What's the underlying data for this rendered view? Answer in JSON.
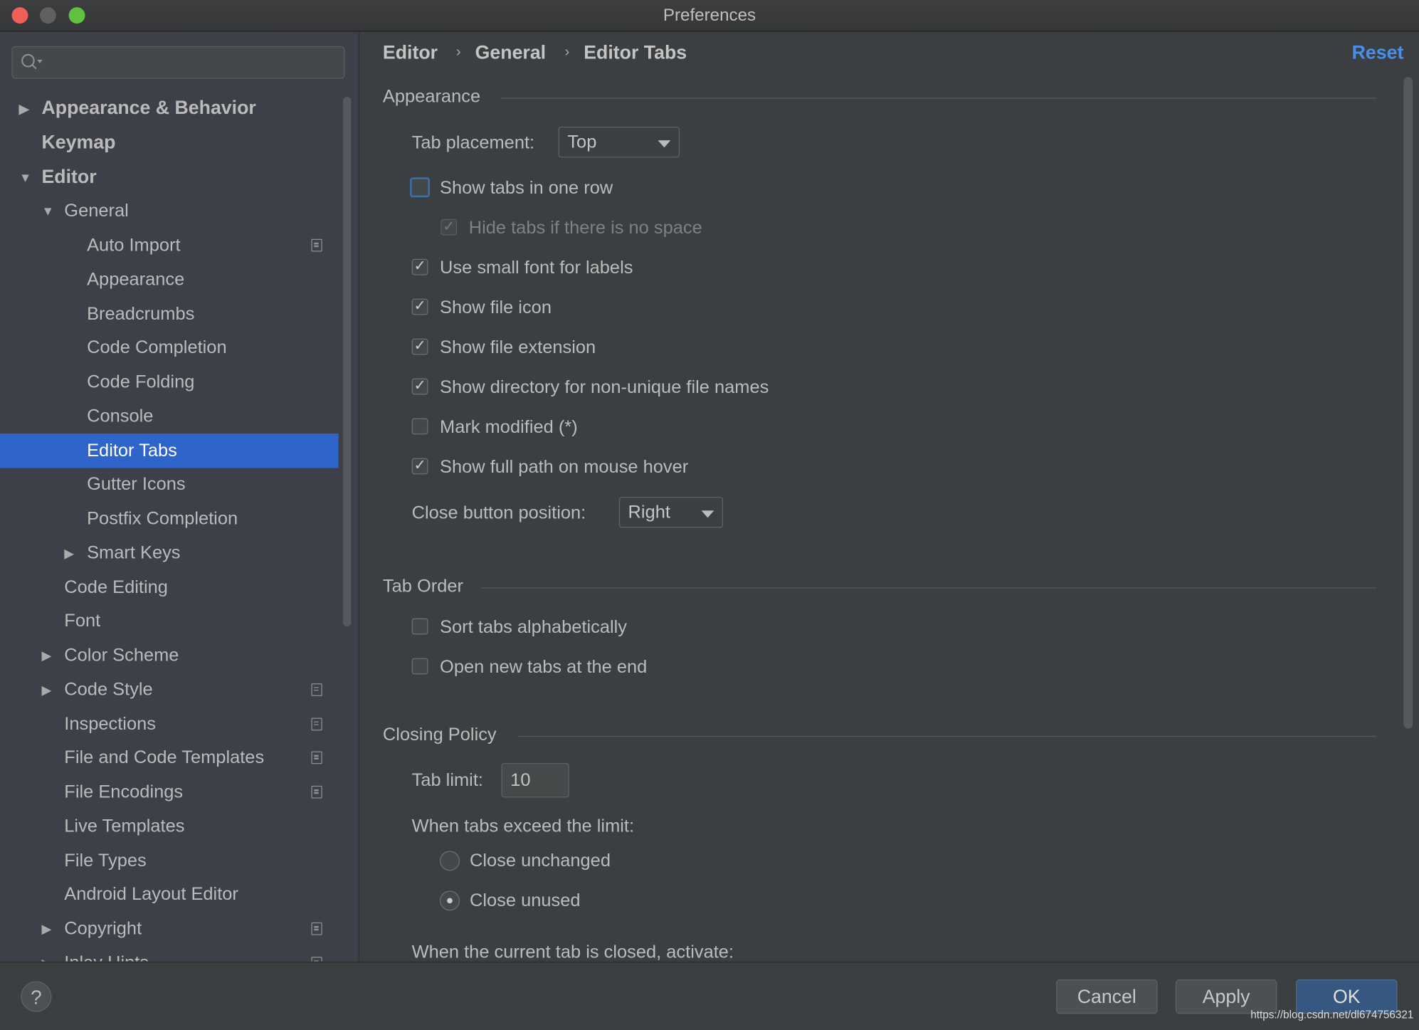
{
  "window": {
    "title": "Preferences",
    "traffic_colors": {
      "close": "#ee5f58",
      "minimize": "#5f6062",
      "zoom": "#62c03f"
    }
  },
  "sidebar": {
    "search_placeholder": "",
    "items": [
      {
        "label": "Appearance & Behavior",
        "level": 0,
        "arrow": "right",
        "bold": true
      },
      {
        "label": "Keymap",
        "level": 0,
        "arrow": "",
        "bold": true
      },
      {
        "label": "Editor",
        "level": 0,
        "arrow": "down",
        "bold": true
      },
      {
        "label": "General",
        "level": 1,
        "arrow": "down"
      },
      {
        "label": "Auto Import",
        "level": 2,
        "arrow": "",
        "cfg": true
      },
      {
        "label": "Appearance",
        "level": 2,
        "arrow": ""
      },
      {
        "label": "Breadcrumbs",
        "level": 2,
        "arrow": ""
      },
      {
        "label": "Code Completion",
        "level": 2,
        "arrow": ""
      },
      {
        "label": "Code Folding",
        "level": 2,
        "arrow": ""
      },
      {
        "label": "Console",
        "level": 2,
        "arrow": ""
      },
      {
        "label": "Editor Tabs",
        "level": 2,
        "arrow": "",
        "selected": true
      },
      {
        "label": "Gutter Icons",
        "level": 2,
        "arrow": ""
      },
      {
        "label": "Postfix Completion",
        "level": 2,
        "arrow": ""
      },
      {
        "label": "Smart Keys",
        "level": 2,
        "arrow": "right"
      },
      {
        "label": "Code Editing",
        "level": 1,
        "arrow": ""
      },
      {
        "label": "Font",
        "level": 1,
        "arrow": ""
      },
      {
        "label": "Color Scheme",
        "level": 1,
        "arrow": "right"
      },
      {
        "label": "Code Style",
        "level": 1,
        "arrow": "right",
        "cfg": true
      },
      {
        "label": "Inspections",
        "level": 1,
        "arrow": "",
        "cfg": true
      },
      {
        "label": "File and Code Templates",
        "level": 1,
        "arrow": "",
        "cfg": true
      },
      {
        "label": "File Encodings",
        "level": 1,
        "arrow": "",
        "cfg": true
      },
      {
        "label": "Live Templates",
        "level": 1,
        "arrow": ""
      },
      {
        "label": "File Types",
        "level": 1,
        "arrow": ""
      },
      {
        "label": "Android Layout Editor",
        "level": 1,
        "arrow": ""
      },
      {
        "label": "Copyright",
        "level": 1,
        "arrow": "right",
        "cfg": true
      },
      {
        "label": "Inlay Hints",
        "level": 1,
        "arrow": "right",
        "cfg": true
      }
    ]
  },
  "breadcrumb": [
    "Editor",
    "General",
    "Editor Tabs"
  ],
  "reset_label": "Reset",
  "appearance": {
    "title": "Appearance",
    "tab_placement_label": "Tab placement:",
    "tab_placement_value": "Top",
    "options": [
      {
        "label": "Show tabs in one row",
        "checked": false,
        "focus": true
      },
      {
        "label": "Hide tabs if there is no space",
        "checked": true,
        "disabled": true,
        "indent": true
      },
      {
        "label": "Use small font for labels",
        "checked": true
      },
      {
        "label": "Show file icon",
        "checked": true
      },
      {
        "label": "Show file extension",
        "checked": true
      },
      {
        "label": "Show directory for non-unique file names",
        "checked": true
      },
      {
        "label": "Mark modified (*)",
        "checked": false
      },
      {
        "label": "Show full path on mouse hover",
        "checked": true
      }
    ],
    "close_button_label": "Close button position:",
    "close_button_value": "Right"
  },
  "tab_order": {
    "title": "Tab Order",
    "options": [
      {
        "label": "Sort tabs alphabetically",
        "checked": false
      },
      {
        "label": "Open new tabs at the end",
        "checked": false
      }
    ]
  },
  "closing_policy": {
    "title": "Closing Policy",
    "tab_limit_label": "Tab limit:",
    "tab_limit_value": "10",
    "exceed_label": "When tabs exceed the limit:",
    "radios": [
      {
        "label": "Close unchanged",
        "selected": false
      },
      {
        "label": "Close unused",
        "selected": true
      }
    ],
    "activate_label": "When the current tab is closed, activate:"
  },
  "buttons": {
    "help": "?",
    "cancel": "Cancel",
    "apply": "Apply",
    "ok": "OK"
  },
  "watermark": "https://blog.csdn.net/dl674756321"
}
